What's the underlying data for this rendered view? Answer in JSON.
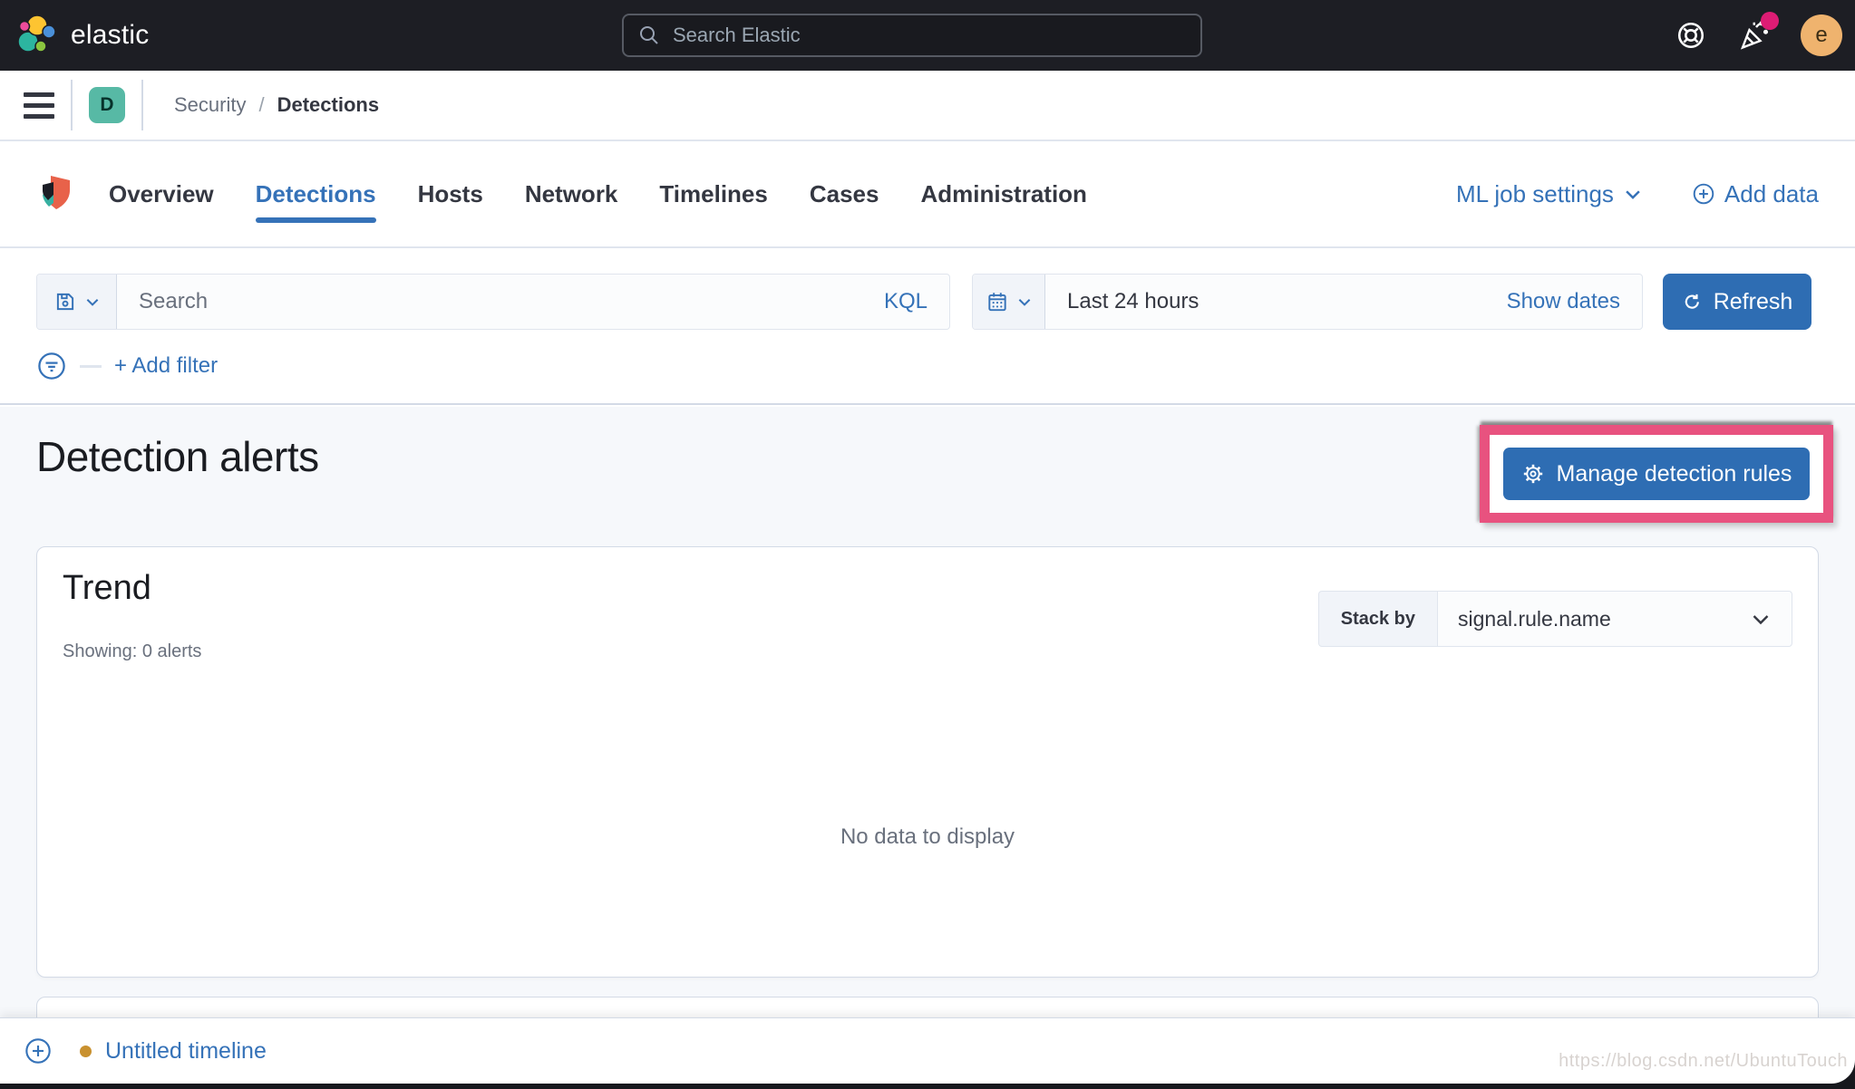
{
  "topbar": {
    "brand": "elastic",
    "search_placeholder": "Search Elastic",
    "avatar_initial": "e"
  },
  "breadcrumb": {
    "space_initial": "D",
    "items": [
      "Security",
      "Detections"
    ],
    "separator": "/"
  },
  "tabs": {
    "items": [
      "Overview",
      "Detections",
      "Hosts",
      "Network",
      "Timelines",
      "Cases",
      "Administration"
    ],
    "active": "Detections",
    "ml_job_settings": "ML job settings",
    "add_data": "Add data"
  },
  "querybar": {
    "search_placeholder": "Search",
    "kql_label": "KQL",
    "time_range": "Last 24 hours",
    "show_dates": "Show dates",
    "refresh_label": "Refresh",
    "add_filter_label": "+ Add filter"
  },
  "page": {
    "title": "Detection alerts",
    "manage_button": "Manage detection rules"
  },
  "trend_panel": {
    "title": "Trend",
    "showing": "Showing: 0 alerts",
    "stack_by_label": "Stack by",
    "stack_by_value": "signal.rule.name",
    "empty_message": "No data to display"
  },
  "timeline_bar": {
    "label": "Untitled timeline"
  },
  "watermark": "https://blog.csdn.net/UbuntuTouch",
  "colors": {
    "primary_button": "#2e6db3",
    "link": "#3572b8",
    "highlight_annotation": "#e8527f",
    "notification_dot": "#dd1c74",
    "space_badge": "#57b9a5",
    "timeline_dot": "#c9912f",
    "top_bar": "#1d1e24"
  }
}
